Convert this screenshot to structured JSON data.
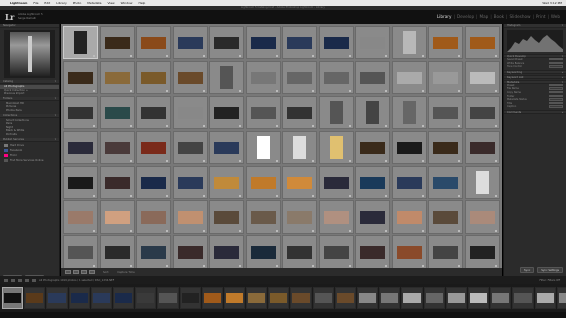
{
  "menubar": {
    "apple": "",
    "items": [
      "Lightroom",
      "File",
      "Edit",
      "Library",
      "Photo",
      "Metadata",
      "View",
      "Window",
      "Help"
    ],
    "right": [
      "Wed 3:12 PM"
    ]
  },
  "window_title": "Lightroom 5 Catalog.lrcat - Adobe Photoshop Lightroom - Library",
  "header": {
    "logo": "Lr",
    "catalog_line1": "Adobe Lightroom 5",
    "catalog_line2": "Serge Ramelli",
    "modules": [
      "Library",
      "Develop",
      "Map",
      "Book",
      "Slideshow",
      "Print",
      "Web"
    ],
    "active_module": "Library"
  },
  "left_panel": {
    "navigator": "Navigator",
    "catalog_header": "Catalog",
    "catalog_rows": [
      {
        "label": "All Photographs",
        "count": "",
        "selected": true
      },
      {
        "label": "Quick Collection +",
        "count": ""
      },
      {
        "label": "Previous Import",
        "count": ""
      }
    ],
    "folders_header": "Folders",
    "folders": [
      {
        "label": "Macintosh HD",
        "count": ""
      },
      {
        "label": "Pictures",
        "count": ""
      },
      {
        "label": "Photos Paris",
        "count": ""
      }
    ],
    "collections_header": "Collections",
    "collections": [
      {
        "label": "Smart Collections",
        "count": ""
      },
      {
        "label": "Paris",
        "count": ""
      },
      {
        "label": "Night",
        "count": ""
      },
      {
        "label": "Black & White",
        "count": ""
      },
      {
        "label": "Portraits",
        "count": ""
      }
    ],
    "publish_header": "Publish Services",
    "publish": [
      {
        "label": "Hard Drive",
        "color": "#777"
      },
      {
        "label": "Facebook",
        "color": "#3b5998"
      },
      {
        "label": "Flickr",
        "color": "#ff0084"
      },
      {
        "label": "Find More Services Online",
        "color": "#555"
      }
    ],
    "import_label": "Import...",
    "export_label": "Export..."
  },
  "grid": {
    "cells": [
      {
        "c": "#222",
        "tall": true,
        "sel": true
      },
      {
        "c": "#3a2a1a"
      },
      {
        "c": "#8a4a1a"
      },
      {
        "c": "#2a3a5a"
      },
      {
        "c": "#2a2a2a"
      },
      {
        "c": "#1a2a4a"
      },
      {
        "c": "#2a3a5a"
      },
      {
        "c": "#1a2a4a"
      },
      {
        "c": "#888"
      },
      {
        "c": "#b8b8b8",
        "tall": true
      },
      {
        "c": "#a05a1a"
      },
      {
        "c": "#a05a1a"
      },
      {
        "c": "#3a2a1a"
      },
      {
        "c": "#8a6a3a"
      },
      {
        "c": "#7a5a2a"
      },
      {
        "c": "#6a4a2a"
      },
      {
        "c": "#555",
        "tall": true
      },
      {
        "c": "#777"
      },
      {
        "c": "#666"
      },
      {
        "c": "#666"
      },
      {
        "c": "#555"
      },
      {
        "c": "#aaa"
      },
      {
        "c": "#999"
      },
      {
        "c": "#bbb"
      },
      {
        "c": "#333"
      },
      {
        "c": "#2a4a4a"
      },
      {
        "c": "#333"
      },
      {
        "c": "#888"
      },
      {
        "c": "#222"
      },
      {
        "c": "#555"
      },
      {
        "c": "#333"
      },
      {
        "c": "#555",
        "tall": true
      },
      {
        "c": "#444",
        "tall": true
      },
      {
        "c": "#666",
        "tall": true
      },
      {
        "c": "#555"
      },
      {
        "c": "#444"
      },
      {
        "c": "#2a2a3a"
      },
      {
        "c": "#4a3a3a"
      },
      {
        "c": "#7a2a1a"
      },
      {
        "c": "#444"
      },
      {
        "c": "#2a3a5a"
      },
      {
        "c": "#fff",
        "tall": true
      },
      {
        "c": "#ddd",
        "tall": true
      },
      {
        "c": "#e0c070",
        "tall": true
      },
      {
        "c": "#3a2a1a"
      },
      {
        "c": "#1a1a1a"
      },
      {
        "c": "#3a2a1a"
      },
      {
        "c": "#3a2a2a"
      },
      {
        "c": "#1a1a1a"
      },
      {
        "c": "#3a2a2a"
      },
      {
        "c": "#1a2a4a"
      },
      {
        "c": "#2a3a5a"
      },
      {
        "c": "#c08a3a"
      },
      {
        "c": "#c07a2a"
      },
      {
        "c": "#d08a3a"
      },
      {
        "c": "#2a2a3a"
      },
      {
        "c": "#1a3a5a"
      },
      {
        "c": "#2a3a5a"
      },
      {
        "c": "#2a4a6a"
      },
      {
        "c": "#ddd",
        "tall": true
      },
      {
        "c": "#9a7a6a"
      },
      {
        "c": "#d0a080"
      },
      {
        "c": "#8a6a5a"
      },
      {
        "c": "#c09070"
      },
      {
        "c": "#5a4a3a"
      },
      {
        "c": "#6a5a4a"
      },
      {
        "c": "#8a7a6a"
      },
      {
        "c": "#b09080"
      },
      {
        "c": "#2a2a3a"
      },
      {
        "c": "#c08a6a"
      },
      {
        "c": "#5a4a3a"
      },
      {
        "c": "#aa8a7a"
      },
      {
        "c": "#555"
      },
      {
        "c": "#2a2a2a"
      },
      {
        "c": "#2a3a4a"
      },
      {
        "c": "#3a2a2a"
      },
      {
        "c": "#2a2a3a"
      },
      {
        "c": "#1a2a3a"
      },
      {
        "c": "#333"
      },
      {
        "c": "#444"
      },
      {
        "c": "#3a2a2a"
      },
      {
        "c": "#8a4a2a"
      },
      {
        "c": "#444"
      },
      {
        "c": "#222"
      }
    ]
  },
  "grid_toolbar": {
    "sort_label": "Sort:",
    "sort_value": "Capture Time"
  },
  "right_panel": {
    "histogram": "Histogram",
    "quick_develop": "Quick Develop",
    "keywording": "Keywording",
    "keyword_list": "Keyword List",
    "metadata": "Metadata",
    "comments": "Comments",
    "rows": [
      {
        "label": "Saved Preset",
        "value": "Default"
      },
      {
        "label": "White Balance",
        "value": "As Shot"
      },
      {
        "label": "Tone Control",
        "value": "Auto Tone"
      },
      {
        "label": "Preset",
        "value": "Default"
      },
      {
        "label": "File Name",
        "value": ""
      },
      {
        "label": "Copy Name",
        "value": ""
      },
      {
        "label": "Folder",
        "value": ""
      },
      {
        "label": "Metadata Status",
        "value": ""
      },
      {
        "label": "Title",
        "value": ""
      },
      {
        "label": "Caption",
        "value": ""
      }
    ],
    "sync_label": "Sync",
    "sync_settings_label": "Sync Settings"
  },
  "filmbar": {
    "source_text": "All Photographs  1019 photos / 1 selected / DSC_1234.NEF",
    "filter_label": "Filter:",
    "filter_value": "Filters Off"
  },
  "filmstrip": {
    "items": [
      "#111",
      "#5a3a1a",
      "#2a3a5a",
      "#1a2a4a",
      "#2a3a5a",
      "#1a2a4a",
      "#3a3a3a",
      "#555",
      "#222",
      "#a05a1a",
      "#c07a2a",
      "#8a6a3a",
      "#7a5a2a",
      "#6a4a2a",
      "#555",
      "#6a4a2a",
      "#888",
      "#777",
      "#aaa",
      "#666",
      "#999",
      "#bbb",
      "#777",
      "#555",
      "#aaa",
      "#888"
    ],
    "selected_index": 0
  }
}
